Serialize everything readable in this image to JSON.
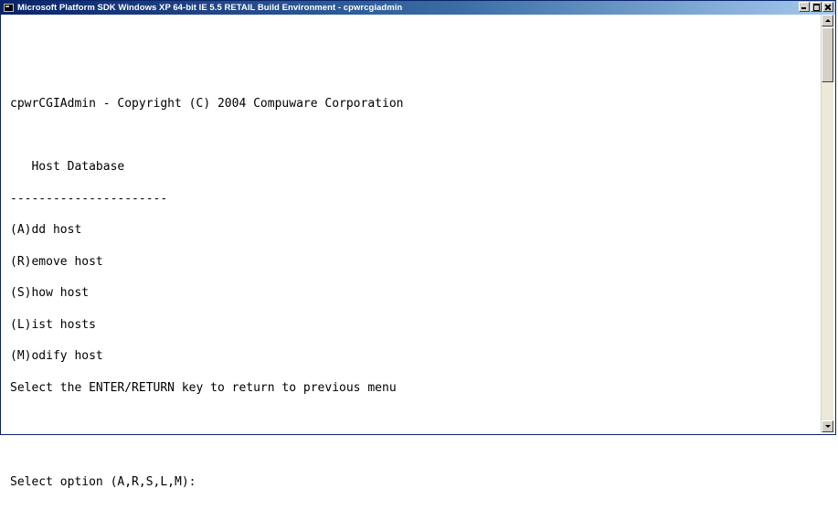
{
  "window": {
    "title": "Microsoft Platform SDK Windows XP 64-bit IE 5.5 RETAIL Build Environment - cpwrcgiadmin"
  },
  "console": {
    "lines": [
      "",
      "",
      "cpwrCGIAdmin - Copyright (C) 2004 Compuware Corporation",
      "",
      "   Host Database",
      "----------------------",
      "(A)dd host",
      "(R)emove host",
      "(S)how host",
      "(L)ist hosts",
      "(M)odify host",
      "Select the ENTER/RETURN key to return to previous menu",
      "",
      "",
      "Select option (A,R,S,L,M):"
    ]
  },
  "colors": {
    "title_bar_start": "#0a246a",
    "title_bar_end": "#a6caf0",
    "console_bg": "#ffffff",
    "console_text": "#000000"
  }
}
